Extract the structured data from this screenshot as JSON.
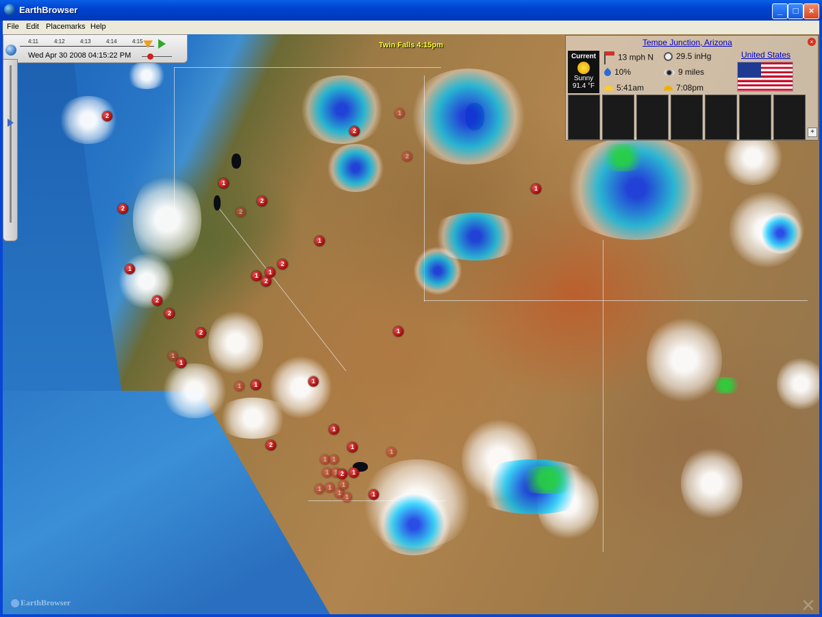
{
  "window": {
    "title": "EarthBrowser",
    "controls": {
      "minimize": "_",
      "maximize": "□",
      "close": "×"
    }
  },
  "menu": {
    "items": [
      "File",
      "Edit",
      "Placemarks",
      "Help"
    ]
  },
  "timeline": {
    "ticks": [
      "4:11",
      "4:12",
      "4:13",
      "4:14",
      "4:15"
    ],
    "datetime": "Wed Apr 30 2008 04:15:22 PM"
  },
  "map": {
    "city_label": "Twin Falls 4:15pm",
    "markers": [
      "2",
      "2",
      "1",
      "2",
      "2",
      "2",
      "1",
      "1",
      "1",
      "2",
      "1",
      "2",
      "2",
      "2",
      "1",
      "2",
      "1",
      "1",
      "1",
      "1",
      "1",
      "2",
      "1",
      "1",
      "1",
      "1",
      "2",
      "1",
      "1",
      "1",
      "1",
      "1",
      "2",
      "1",
      "1",
      "1",
      "1",
      "1",
      "1",
      "1"
    ],
    "watermark": "EarthBrowser"
  },
  "weather": {
    "location": "Tempe Junction, Arizona",
    "country": "United States",
    "current_label": "Current",
    "condition": "Sunny",
    "temperature": "91.4 °F",
    "wind": "13 mph N",
    "pressure": "29.5 inHg",
    "humidity": "10%",
    "visibility": "9 miles",
    "sunrise": "5:41am",
    "sunset": "7:08pm",
    "close": "×",
    "side_controls": [
      "+"
    ],
    "colors": {
      "link": "#0000cc",
      "sun": "#ffd020"
    }
  }
}
